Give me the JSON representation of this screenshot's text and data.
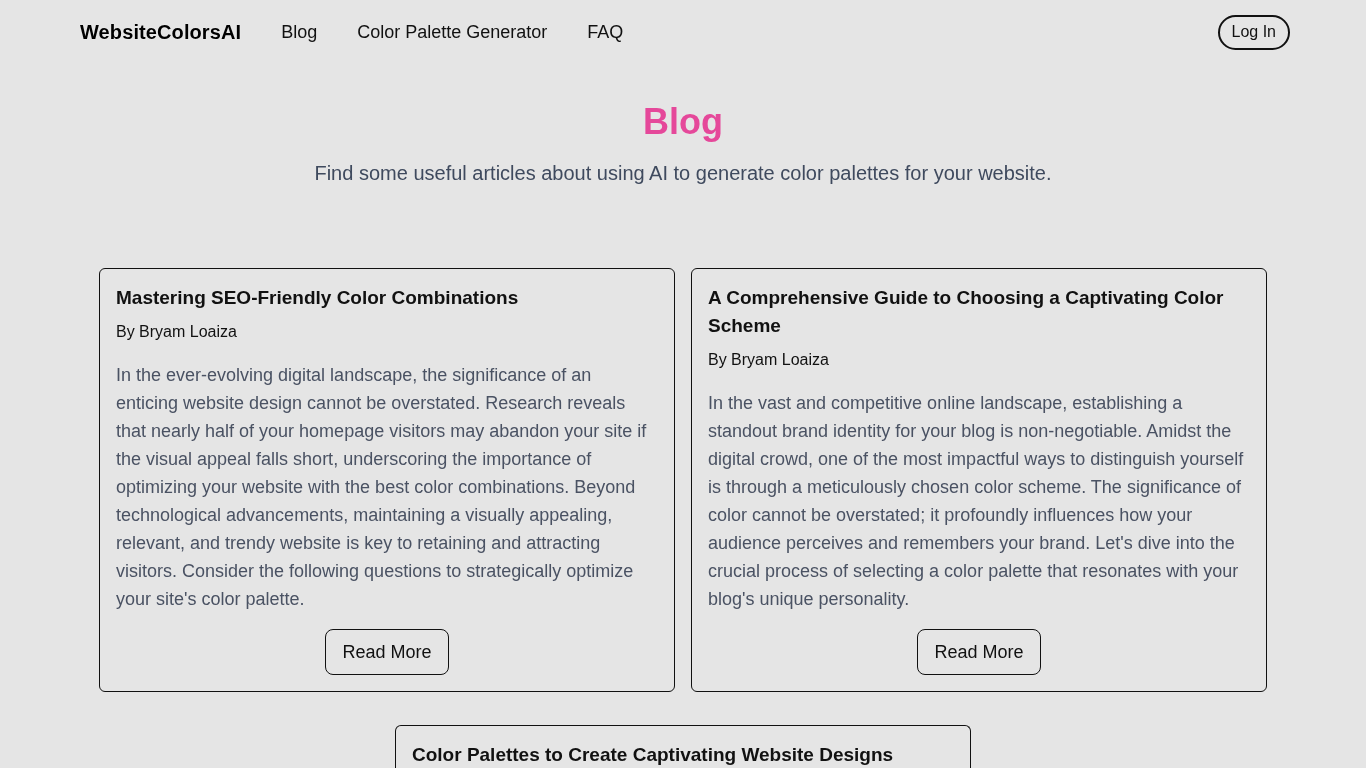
{
  "header": {
    "logo": "WebsiteColorsAI",
    "nav": [
      {
        "label": "Blog"
      },
      {
        "label": "Color Palette Generator"
      },
      {
        "label": "FAQ"
      }
    ],
    "login_button": "Log In"
  },
  "hero": {
    "title": "Blog",
    "subtitle": "Find some useful articles about using AI to generate color palettes for your website."
  },
  "posts": [
    {
      "title": "Mastering SEO-Friendly Color Combinations",
      "author": "By Bryam Loaiza",
      "excerpt": "In the ever-evolving digital landscape, the significance of an enticing website design cannot be overstated. Research reveals that nearly half of your homepage visitors may abandon your site if the visual appeal falls short, underscoring the importance of optimizing your website with the best color combinations. Beyond technological advancements, maintaining a visually appealing, relevant, and trendy website is key to retaining and attracting visitors. Consider the following questions to strategically optimize your site's color palette.",
      "button": "Read More"
    },
    {
      "title": "A Comprehensive Guide to Choosing a Captivating Color Scheme",
      "author": "By Bryam Loaiza",
      "excerpt": "In the vast and competitive online landscape, establishing a standout brand identity for your blog is non-negotiable. Amidst the digital crowd, one of the most impactful ways to distinguish yourself is through a meticulously chosen color scheme. The significance of color cannot be overstated; it profoundly influences how your audience perceives and remembers your brand. Let's dive into the crucial process of selecting a color palette that resonates with your blog's unique personality.",
      "button": "Read More"
    },
    {
      "title": "Color Palettes to Create Captivating Website Designs"
    }
  ]
}
